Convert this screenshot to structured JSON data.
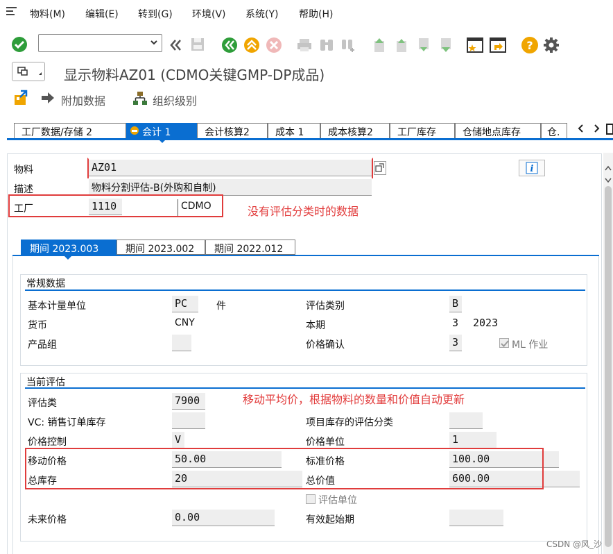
{
  "menu": {
    "items": [
      "物料(M)",
      "编辑(E)",
      "转到(G)",
      "环境(V)",
      "系统(Y)",
      "帮助(H)"
    ]
  },
  "toolbar": {
    "command_value": ""
  },
  "title": "显示物料AZ01 (CDMO关键GMP-DP成品)",
  "app_toolbar": {
    "additional_data": "附加数据",
    "org_levels": "组织级别"
  },
  "tabs": [
    "工厂数据/存储 2",
    "会计 1",
    "会计核算2",
    "成本 1",
    "成本核算2",
    "工厂库存",
    "仓储地点库存",
    "仓."
  ],
  "header": {
    "material_label": "物料",
    "material_value": "AZ01",
    "desc_label": "描述",
    "desc_value": "物料分割评估-B(外购和自制)",
    "plant_label": "工厂",
    "plant_value": "1110",
    "plant_name": "CDMO"
  },
  "annotations": {
    "no_valuation": "没有评估分类时的数据",
    "moving_avg": "移动平均价，根据物料的数量和价值自动更新"
  },
  "period_tabs": [
    "期间 2023.003",
    "期间 2023.002",
    "期间 2022.012"
  ],
  "general": {
    "title": "常规数据",
    "base_uom_label": "基本计量单位",
    "base_uom_value": "PC",
    "base_uom_text": "件",
    "currency_label": "货币",
    "currency_value": "CNY",
    "product_group_label": "产品组",
    "valuation_cat_label": "评估类别",
    "valuation_cat_value": "B",
    "current_period_label": "本期",
    "current_period_value": "3",
    "current_year_value": "2023",
    "price_det_label": "价格确认",
    "price_det_value": "3",
    "ml_label": "ML 作业"
  },
  "current": {
    "title": "当前评估",
    "val_class_label": "评估类",
    "val_class_value": "7900",
    "vc_label": "VC: 销售订单库存",
    "proj_label": "项目库存的评估分类",
    "price_ctrl_label": "价格控制",
    "price_ctrl_value": "V",
    "price_unit_label": "价格单位",
    "price_unit_value": "1",
    "moving_price_label": "移动价格",
    "moving_price_value": "50.00",
    "std_price_label": "标准价格",
    "std_price_value": "100.00",
    "total_stock_label": "总库存",
    "total_stock_value": "20",
    "total_value_label": "总价值",
    "total_value_value": "600.00",
    "val_unit_label": "评估单位",
    "future_price_label": "未来价格",
    "future_price_value": "0.00",
    "valid_from_label": "有效起始期"
  },
  "watermark": "CSDN @风_沙"
}
